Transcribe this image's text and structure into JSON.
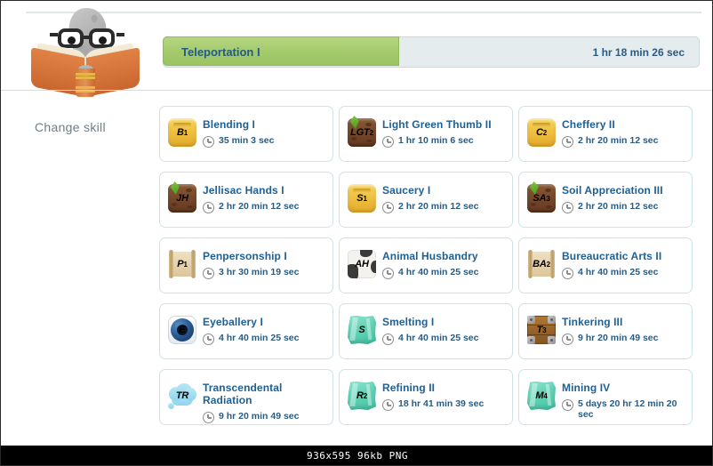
{
  "window": {
    "footer_text": "936x595 96kb PNG"
  },
  "sidebar": {
    "change_skill_label": "Change skill",
    "mascot_name": "rock-reading-book-mascot"
  },
  "progress": {
    "skill_label": "Teleportation I",
    "time_remaining": "1 hr 18 min 26 sec",
    "fill_percent": 44,
    "fill_color": "#a3c96a",
    "track_color": "#e4eced"
  },
  "skills": [
    {
      "title": "Blending I",
      "time": "35 min 3 sec",
      "icon": "gold-tile-icon",
      "abbr": "B",
      "level": "1"
    },
    {
      "title": "Light Green Thumb II",
      "time": "1 hr 10 min 6 sec",
      "icon": "dirt-tile-icon",
      "abbr": "LGT",
      "level": "2"
    },
    {
      "title": "Cheffery II",
      "time": "2 hr 20 min 12 sec",
      "icon": "gold-tile-icon",
      "abbr": "C",
      "level": "2"
    },
    {
      "title": "Jellisac Hands I",
      "time": "2 hr 20 min 12 sec",
      "icon": "dirt-tile-icon",
      "abbr": "JH",
      "level": ""
    },
    {
      "title": "Saucery I",
      "time": "2 hr 20 min 12 sec",
      "icon": "gold-tile-icon",
      "abbr": "S",
      "level": "1"
    },
    {
      "title": "Soil Appreciation III",
      "time": "2 hr 20 min 12 sec",
      "icon": "dirt-tile-icon",
      "abbr": "SA",
      "level": "3"
    },
    {
      "title": "Penpersonship I",
      "time": "3 hr 30 min 19 sec",
      "icon": "scroll-icon",
      "abbr": "P",
      "level": "1"
    },
    {
      "title": "Animal Husbandry",
      "time": "4 hr 40 min 25 sec",
      "icon": "cow-hide-icon",
      "abbr": "AH",
      "level": ""
    },
    {
      "title": "Bureaucratic Arts II",
      "time": "4 hr 40 min 25 sec",
      "icon": "scroll-icon",
      "abbr": "BA",
      "level": "2"
    },
    {
      "title": "Eyeballery I",
      "time": "4 hr 40 min 25 sec",
      "icon": "eyeball-icon",
      "abbr": "E",
      "level": ""
    },
    {
      "title": "Smelting I",
      "time": "4 hr 40 min 25 sec",
      "icon": "crystal-icon",
      "abbr": "S",
      "level": ""
    },
    {
      "title": "Tinkering III",
      "time": "9 hr 20 min 49 sec",
      "icon": "wooden-crate-icon",
      "abbr": "T",
      "level": "3"
    },
    {
      "title": "Transcendental Radiation",
      "time": "9 hr 20 min 49 sec",
      "icon": "cloud-icon",
      "abbr": "TR",
      "level": ""
    },
    {
      "title": "Refining II",
      "time": "18 hr 41 min 39 sec",
      "icon": "crystal-icon",
      "abbr": "R",
      "level": "2"
    },
    {
      "title": "Mining IV",
      "time": "5 days 20 hr 12 min 20 sec",
      "icon": "crystal-icon",
      "abbr": "M",
      "level": "4"
    }
  ]
}
